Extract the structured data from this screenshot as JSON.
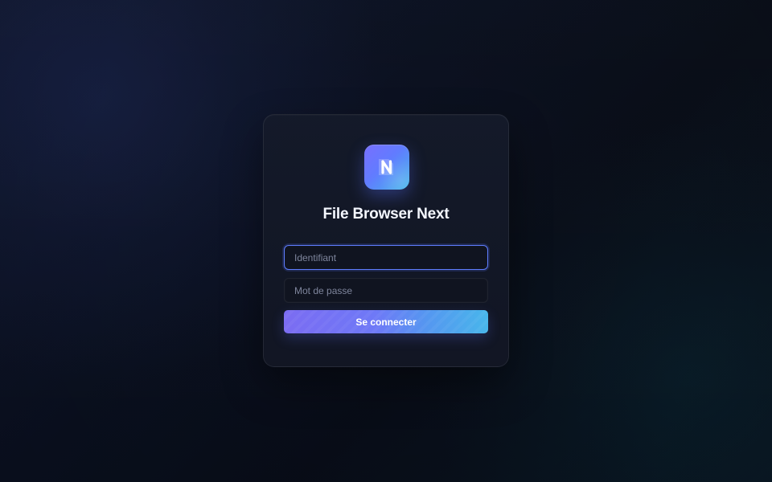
{
  "app": {
    "title": "File Browser Next"
  },
  "login": {
    "username_placeholder": "Identifiant",
    "username_value": "",
    "password_placeholder": "Mot de passe",
    "password_value": "",
    "submit_label": "Se connecter"
  },
  "icons": {
    "logo": "file-browser-next-logo-icon"
  },
  "colors": {
    "accent_start": "#7b6cf2",
    "accent_mid": "#5a76ff",
    "accent_end": "#48b6eb",
    "card_background": "#141a2a",
    "page_background": "#0a1020",
    "focus_border": "#5e7dff"
  }
}
